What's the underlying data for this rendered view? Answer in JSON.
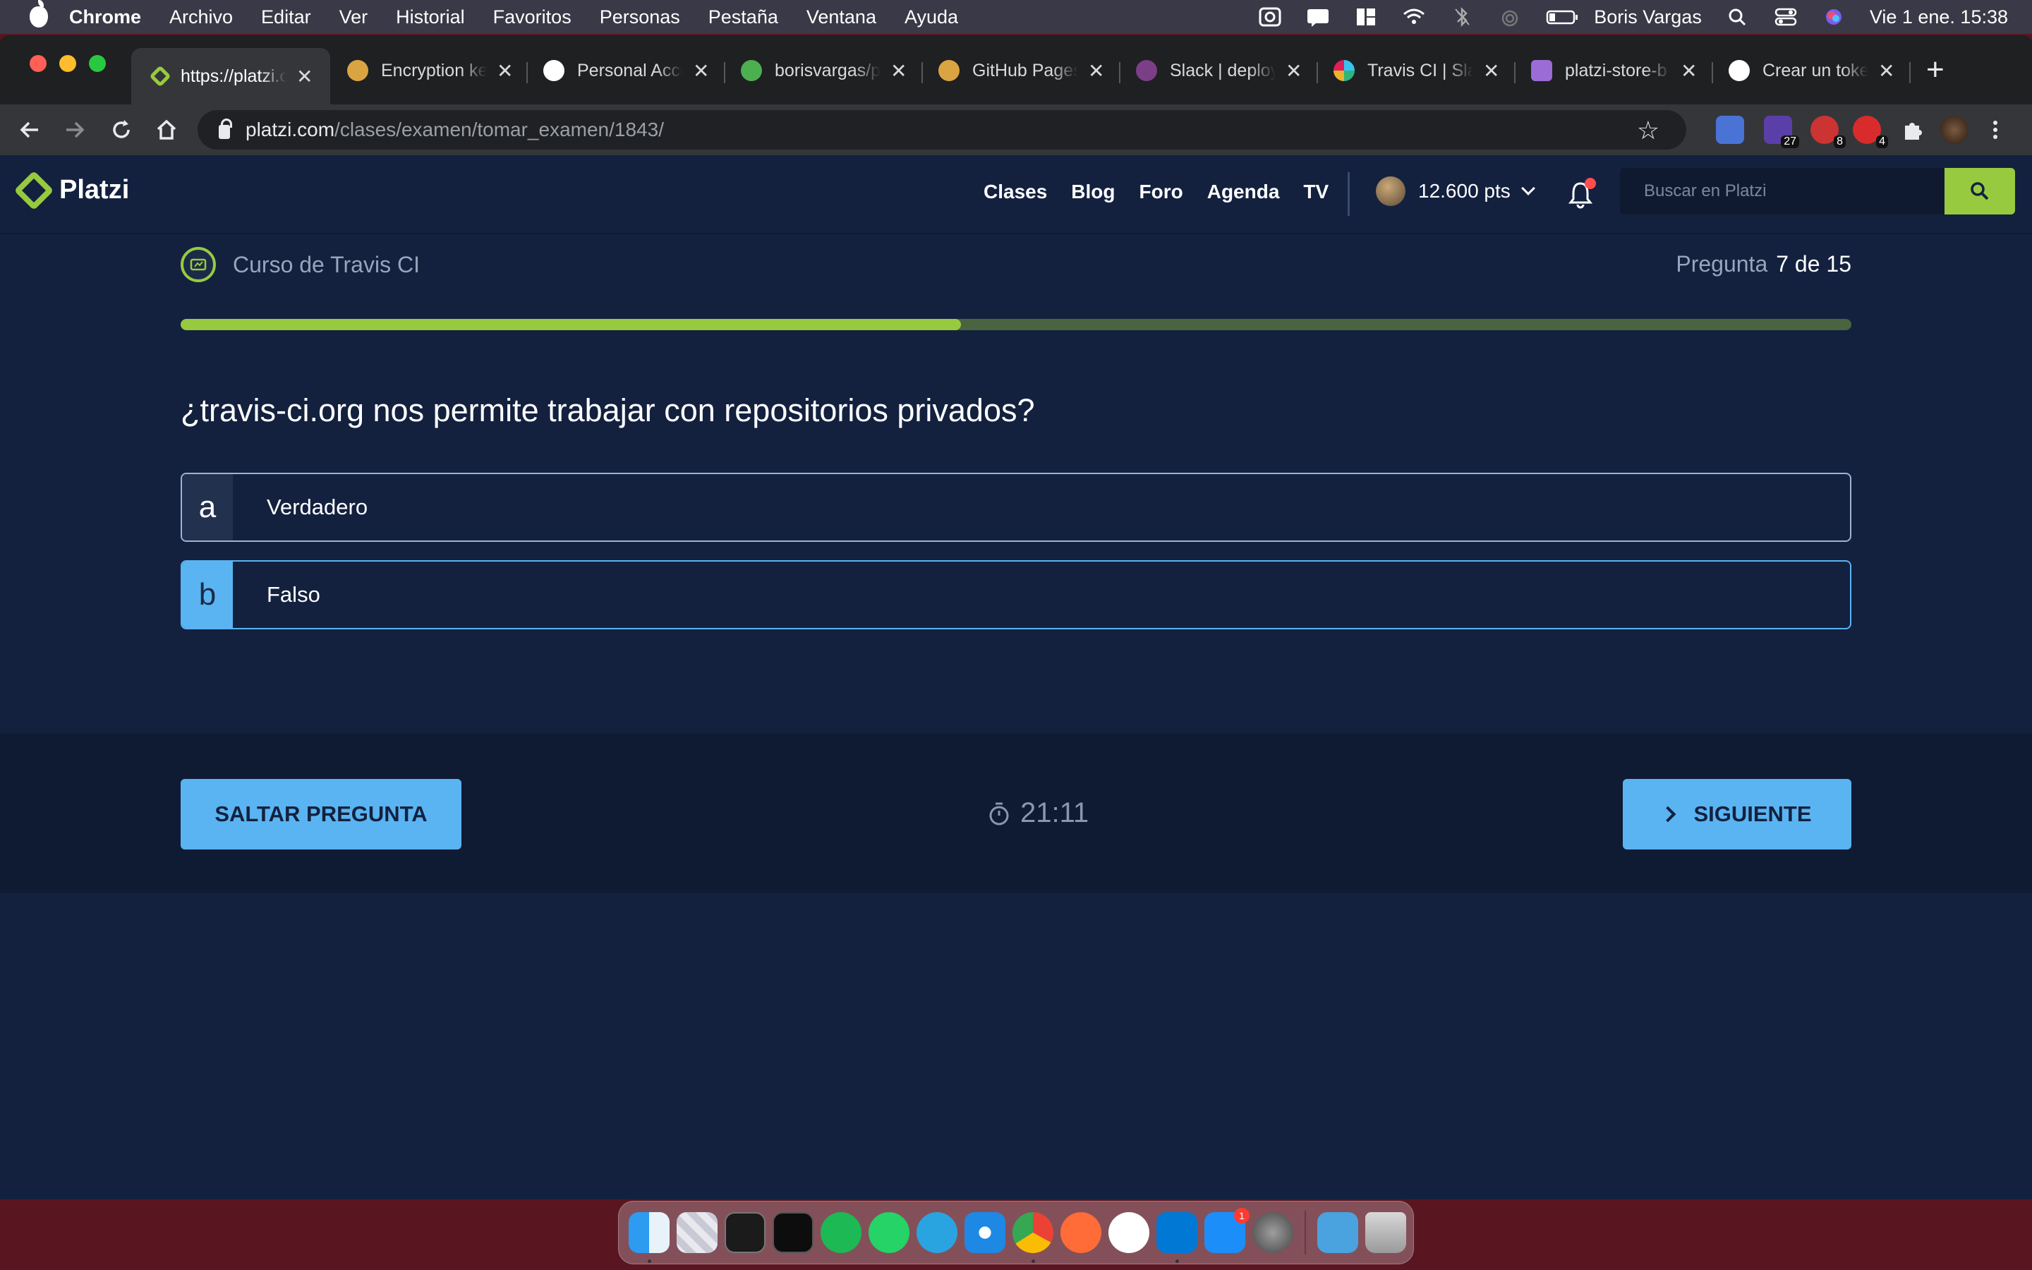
{
  "menubar": {
    "app": "Chrome",
    "items": [
      "Archivo",
      "Editar",
      "Ver",
      "Historial",
      "Favoritos",
      "Personas",
      "Pestaña",
      "Ventana",
      "Ayuda"
    ],
    "user": "Boris Vargas",
    "datetime": "Vie 1 ene.  15:38"
  },
  "tabs": [
    {
      "title": "https://platzi.com",
      "favicon_color": "#98ca3f",
      "active": true
    },
    {
      "title": "Encryption keys",
      "favicon_color": "#d9a441",
      "active": false
    },
    {
      "title": "Personal Access",
      "favicon_color": "#ffffff",
      "active": false
    },
    {
      "title": "borisvargas/p",
      "favicon_color": "#4caf50",
      "active": false
    },
    {
      "title": "GitHub Pages",
      "favicon_color": "#d9a441",
      "active": false
    },
    {
      "title": "Slack | deploy",
      "favicon_color": "#7a3f86",
      "active": false
    },
    {
      "title": "Travis CI | Sla",
      "favicon_color": "#e01e5a",
      "active": false
    },
    {
      "title": "platzi-store-b",
      "favicon_color": "#9b6bd6",
      "active": false
    },
    {
      "title": "Crear un token",
      "favicon_color": "#ffffff",
      "active": false
    }
  ],
  "address_bar": {
    "host": "platzi.com",
    "path": "/clases/examen/tomar_examen/1843/"
  },
  "extensions": [
    {
      "icon": "translate-icon",
      "badge": ""
    },
    {
      "icon": "extension-icon",
      "badge": "27"
    },
    {
      "icon": "extension-icon",
      "badge": "8"
    },
    {
      "icon": "adblock-icon",
      "badge": "4"
    },
    {
      "icon": "puzzle-icon",
      "badge": ""
    }
  ],
  "platzi_header": {
    "brand": "Platzi",
    "nav": [
      "Clases",
      "Blog",
      "Foro",
      "Agenda",
      "TV"
    ],
    "points": "12.600 pts",
    "search_placeholder": "Buscar en Platzi"
  },
  "exam": {
    "course": "Curso de Travis CI",
    "question_label": "Pregunta",
    "question_counter": "7 de 15",
    "progress": 0.467,
    "question": "¿travis-ci.org nos permite trabajar con repositorios privados?",
    "answers": [
      {
        "letter": "a",
        "text": "Verdadero",
        "selected": false
      },
      {
        "letter": "b",
        "text": "Falso",
        "selected": true
      }
    ],
    "skip_label": "SALTAR PREGUNTA",
    "next_label": "SIGUIENTE",
    "timer": "21:11"
  },
  "colors": {
    "platzi_green": "#98ca3f",
    "platzi_bg": "#13213f",
    "accent_blue": "#5ab4f2"
  },
  "dock": {
    "apps": [
      "finder-icon",
      "launchpad-icon",
      "terminal-icon",
      "iterm-icon",
      "spotify-icon",
      "whatsapp-icon",
      "telegram-icon",
      "safari-icon",
      "chrome-icon",
      "postman-icon",
      "notion-icon",
      "vscode-icon",
      "app-store-icon",
      "system-preferences-icon",
      "downloads-folder-icon",
      "trash-icon"
    ],
    "app_store_badge": "1"
  }
}
